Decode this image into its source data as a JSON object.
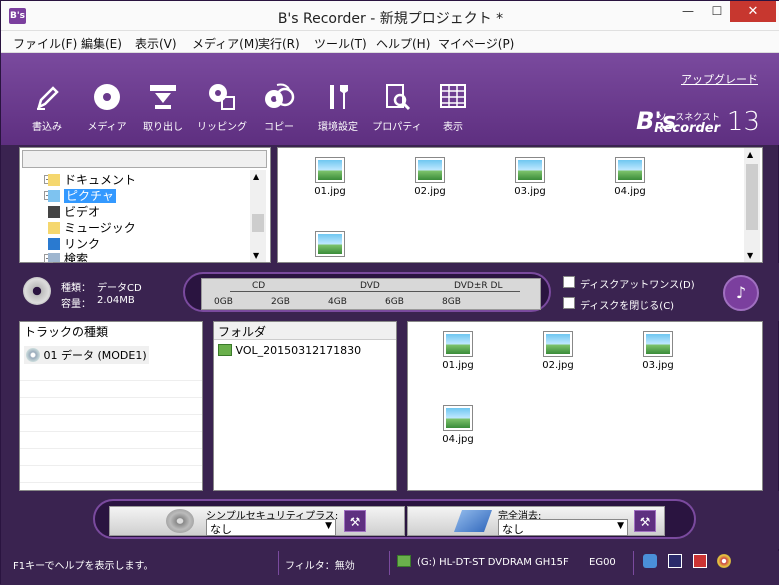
{
  "window": {
    "title": "B's Recorder - 新規プロジェクト *",
    "app_icon": "B's",
    "min": "—",
    "max": "☐",
    "close": "✕"
  },
  "menu": [
    "ファイル(F)",
    "編集(E)",
    "表示(V)",
    "メディア(M)",
    "実行(R)",
    "ツール(T)",
    "ヘルプ(H)",
    "マイページ(P)"
  ],
  "toolbar": {
    "buttons": [
      {
        "label": "書込み",
        "icon": "pencil-icon"
      },
      {
        "label": "メディア",
        "icon": "disc-icon"
      },
      {
        "label": "取り出し",
        "icon": "eject-icon"
      },
      {
        "label": "リッピング",
        "icon": "ripping-icon"
      },
      {
        "label": "コピー",
        "icon": "copy-discs-icon"
      },
      {
        "label": "環境設定",
        "icon": "settings-tools-icon"
      },
      {
        "label": "プロパティ",
        "icon": "properties-icon"
      },
      {
        "label": "表示",
        "icon": "view-icon"
      }
    ],
    "upgrade_link": "アップグレード",
    "brand_b": "B's",
    "brand_source": "ソースネクスト",
    "brand_recorder": "Recorder",
    "brand_version": "13"
  },
  "tree": {
    "items": [
      "ドキュメント",
      "ピクチャ",
      "ビデオ",
      "ミュージック",
      "リンク",
      "検索"
    ],
    "selected": "ピクチャ"
  },
  "source_files": [
    "01.jpg",
    "02.jpg",
    "03.jpg",
    "04.jpg",
    ""
  ],
  "disc_info": {
    "type_label": "種類：",
    "type_value": "データCD",
    "size_label": "容量：",
    "size_value": "2.04MB",
    "media_labels": [
      "CD",
      "DVD",
      "DVD±R DL"
    ],
    "gauge_ticks": [
      "0GB",
      "2GB",
      "4GB",
      "6GB",
      "8GB"
    ],
    "disc_at_once": "ディスクアットワンス(D)",
    "close_disc": "ディスクを閉じる(C)"
  },
  "track": {
    "header": "トラックの種類",
    "item": "01 データ (MODE1)"
  },
  "folder": {
    "header": "フォルダ",
    "item": "VOL_20150312171830"
  },
  "project_files": [
    "01.jpg",
    "02.jpg",
    "03.jpg",
    "04.jpg"
  ],
  "bottom": {
    "security_label": "シンプルセキュリティプラス:",
    "security_value": "なし",
    "erase_label": "完全消去:",
    "erase_value": "なし"
  },
  "status": {
    "help": "F1キーでヘルプを表示します。",
    "filter": "フィルタ：無効",
    "drive": "(G:) HL-DT-ST DVDRAM GH15F",
    "drive_fw": "EG00"
  }
}
